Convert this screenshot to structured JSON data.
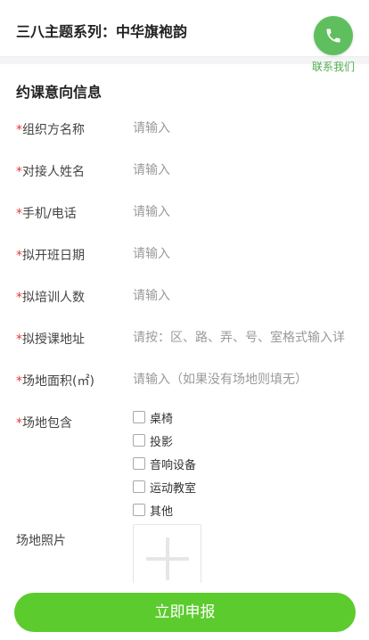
{
  "header": {
    "title": "三八主题系列：中华旗袍韵"
  },
  "contact": {
    "label": "联系我们"
  },
  "form": {
    "section_title": "约课意向信息",
    "required_mark": "*",
    "fields": [
      {
        "label": "组织方名称",
        "placeholder": "请输入",
        "required": true
      },
      {
        "label": "对接人姓名",
        "placeholder": "请输入",
        "required": true
      },
      {
        "label": "手机/电话",
        "placeholder": "请输入",
        "required": true
      },
      {
        "label": "拟开班日期",
        "placeholder": "请输入",
        "required": true
      },
      {
        "label": "拟培训人数",
        "placeholder": "请输入",
        "required": true
      },
      {
        "label": "拟授课地址",
        "placeholder": "请按：区、路、弄、号、室格式输入详",
        "required": true
      },
      {
        "label": "场地面积(㎡)",
        "placeholder": "请输入（如果没有场地则填无）",
        "required": true
      }
    ],
    "venue_includes": {
      "label": "场地包含",
      "options": [
        "桌椅",
        "投影",
        "音响设备",
        "运动教室",
        "其他"
      ]
    },
    "venue_photo": {
      "label": "场地照片"
    }
  },
  "submit": {
    "label": "立即申报"
  },
  "colors": {
    "accent": "#5ccb2e",
    "contact": "#5fbf5f",
    "required": "#e33333"
  },
  "icons": {
    "contact": "phone-icon",
    "upload": "plus-icon"
  }
}
